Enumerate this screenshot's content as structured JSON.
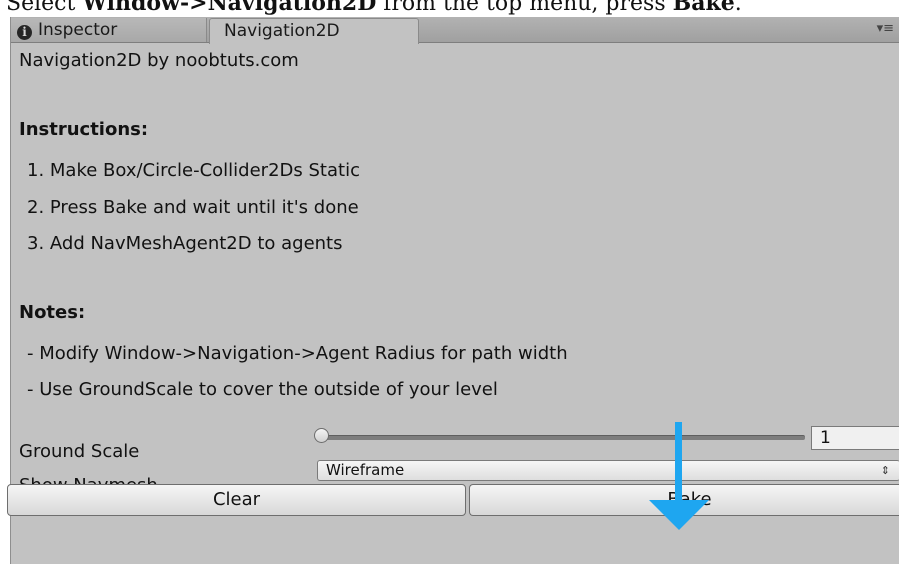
{
  "caption": {
    "prefix": "Select ",
    "menu": "Window",
    "separator": "->",
    "item": "Navigation2D",
    "middle": " from the top menu, press ",
    "action": "Bake",
    "end": "."
  },
  "tabs": [
    {
      "label": "Inspector",
      "icon": "info-icon",
      "active": false
    },
    {
      "label": "Navigation2D",
      "active": true
    }
  ],
  "panel_menu_icon": "▾≡",
  "content": {
    "title_line": "Navigation2D by noobtuts.com",
    "instructions_heading": "Instructions:",
    "instructions": [
      "1. Make Box/Circle-Collider2Ds Static",
      "2. Press Bake and wait until it's done",
      "3. Add NavMeshAgent2D to agents"
    ],
    "notes_heading": "Notes:",
    "notes": [
      "- Modify Window->Navigation->Agent Radius for path width",
      "- Use GroundScale to cover the outside of your level"
    ]
  },
  "fields": {
    "ground_scale_label": "Ground Scale",
    "ground_scale_value": "1",
    "ground_scale_slider_fraction": 0.0,
    "show_navmesh_label": "Show Navmesh",
    "show_navmesh_value": "Wireframe"
  },
  "buttons": {
    "clear": "Clear",
    "bake": "Bake"
  },
  "colors": {
    "panel_bg": "#c2c2c2",
    "annotation_arrow": "#1ea6f0"
  }
}
